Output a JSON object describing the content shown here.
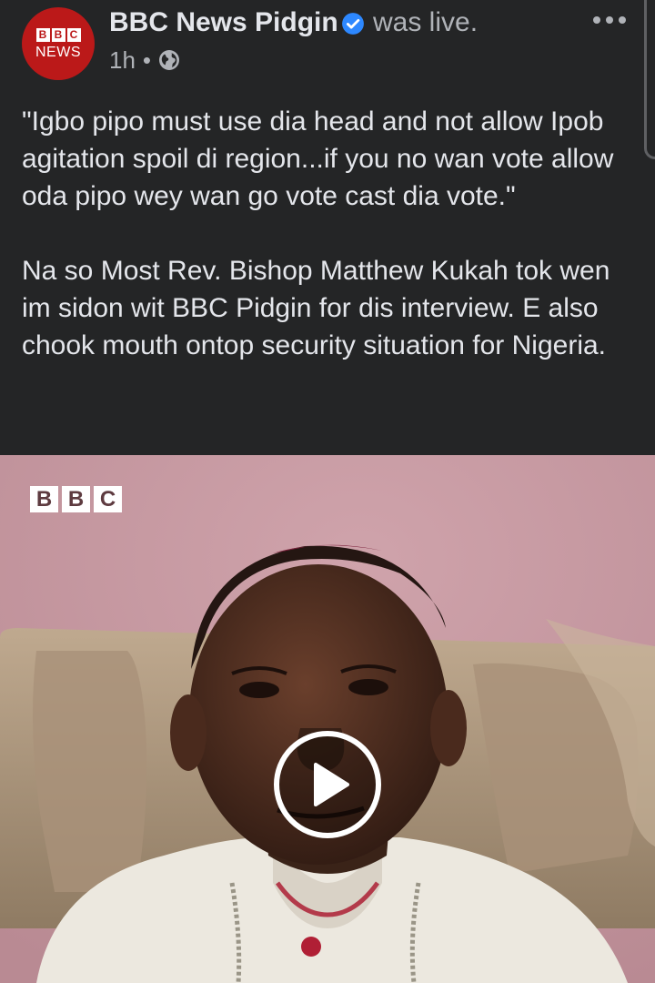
{
  "post": {
    "page_name": "BBC News Pidgin",
    "status_text": "was live.",
    "time": "1h",
    "separator": "•",
    "avatar": {
      "blocks": [
        "B",
        "B",
        "C"
      ],
      "word": "NEWS",
      "color": "#bb1919"
    },
    "verified_icon": "verified-badge-icon",
    "privacy_icon": "globe-icon",
    "more_icon": "more-options-icon"
  },
  "body": {
    "paragraphs": [
      "\"Igbo pipo must use dia head and not allow Ipob agitation spoil di region...if you no wan vote allow oda pipo wey wan go vote cast dia vote.\"",
      "Na so Most Rev. Bishop Matthew Kukah tok wen im sidon wit BBC Pidgin for dis interview. E also chook mouth ontop security situation for Nigeria."
    ]
  },
  "video": {
    "watermark_blocks": [
      "B",
      "B",
      "C"
    ],
    "play_icon": "play-button-icon"
  },
  "colors": {
    "background": "#242526",
    "text_primary": "#e4e6eb",
    "text_secondary": "#b0b3b8",
    "verified": "#2d88ff",
    "brand_red": "#bb1919"
  }
}
